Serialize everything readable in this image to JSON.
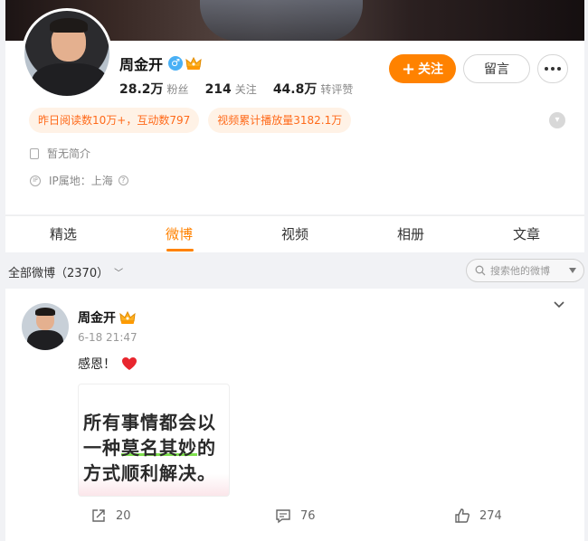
{
  "profile": {
    "name": "周金开",
    "gender_symbol": "♂",
    "stats": [
      {
        "value": "28.2万",
        "label": "粉丝"
      },
      {
        "value": "214",
        "label": "关注"
      },
      {
        "value": "44.8万",
        "label": "转评赞"
      }
    ],
    "follow_label": "关注",
    "follow_plus": "+",
    "message_label": "留言",
    "highlights": [
      "昨日阅读数10万+，互动数797",
      "视频累计播放量3182.1万"
    ],
    "bio": "暂无简介",
    "ip_location": "IP属地：上海",
    "accent_color": "#ff8200"
  },
  "tabs": [
    "精选",
    "微博",
    "视频",
    "相册",
    "文章"
  ],
  "active_tab": "微博",
  "filter": {
    "label": "全部微博（2370）",
    "search_placeholder": "搜索他的微博"
  },
  "post": {
    "author": "周金开",
    "time": "6-18 21:47",
    "text": "感恩！",
    "image_text": {
      "line1": "所有事情都会以",
      "line2_pre": "一种",
      "line2_highlight": "莫名其妙",
      "line2_post": "的",
      "line3": "方式顺利解决。"
    },
    "reposts": "20",
    "comments": "76",
    "likes": "274"
  }
}
